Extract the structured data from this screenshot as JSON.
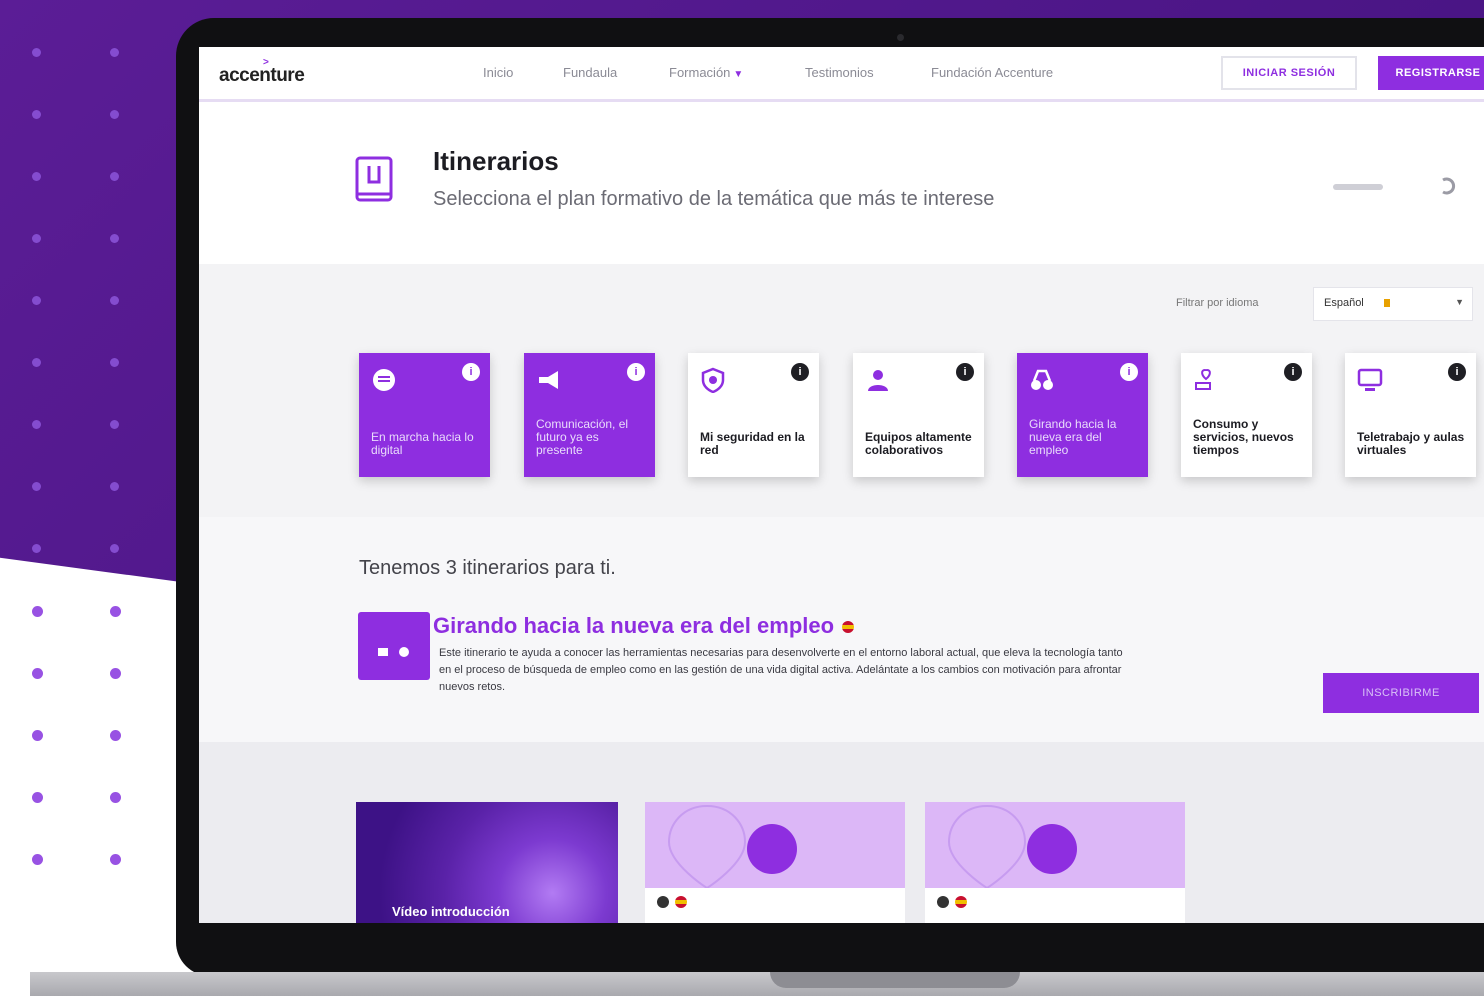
{
  "brand": {
    "logo_text": "accenture",
    "logo_mark": ">",
    "accent_color": "#8e2ee0",
    "background_color": "#4a1585"
  },
  "nav": {
    "links": [
      "Inicio",
      "Fundaula",
      "Formación",
      "Testimonios",
      "Fundación Accenture"
    ],
    "formacion_chevron": "chevron-down-icon",
    "login_label": "INICIAR SESIÓN",
    "register_label": "REGISTRARSE"
  },
  "header": {
    "icon": "book-icon",
    "title": "Itinerarios",
    "subtitle": "Selecciona el plan formativo de la temática que más te interese"
  },
  "filter": {
    "label": "Filtrar por idioma",
    "selected": "Español"
  },
  "themes": [
    {
      "label": "En marcha hacia lo digital",
      "icon": "chat-icon",
      "active": true
    },
    {
      "label": "Comunicación, el futuro ya es presente",
      "icon": "megaphone-icon",
      "active": true
    },
    {
      "label": "Mi seguridad en la red",
      "icon": "shield-icon",
      "active": false
    },
    {
      "label": "Equipos altamente colaborativos",
      "icon": "team-icon",
      "active": false
    },
    {
      "label": "Girando hacia la nueva era del empleo",
      "icon": "binoculars-icon",
      "active": true
    },
    {
      "label": "Consumo y servicios, nuevos tiempos",
      "icon": "heart-cart-icon",
      "active": false
    },
    {
      "label": "Teletrabajo y aulas virtuales",
      "icon": "monitor-icon",
      "active": false
    }
  ],
  "results": {
    "heading": "Tenemos 3 itinerarios para ti.",
    "itinerary_title": "Girando hacia la nueva era del empleo",
    "itinerary_desc": "Este itinerario te ayuda a conocer las herramientas necesarias para desenvolverte en el entorno laboral actual, que eleva la tecnología tanto en el proceso de búsqueda de empleo como en las gestión de una vida digital activa. Adelántate a los cambios con motivación para afrontar nuevos retos.",
    "enroll_label": "INSCRIBIRME"
  },
  "modules": {
    "video_title": "Vídeo introducción",
    "module_icon": "location-pin-icon"
  }
}
